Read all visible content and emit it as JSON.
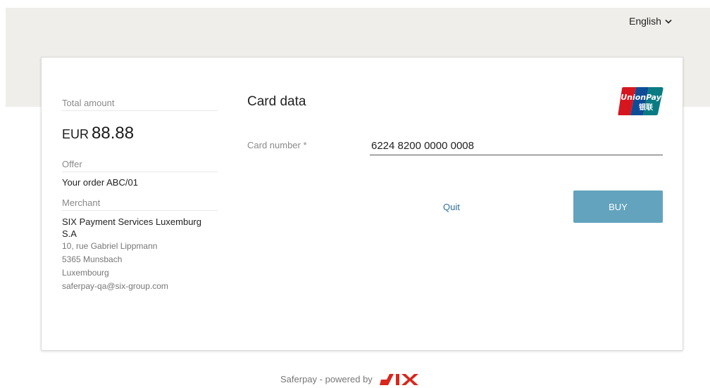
{
  "header": {
    "language": "English",
    "language_icon": "chevron-down-icon"
  },
  "summary": {
    "total_label": "Total amount",
    "currency": "EUR",
    "amount": "88.88",
    "offer_label": "Offer",
    "offer_value": "Your order ABC/01",
    "merchant_label": "Merchant",
    "merchant_name": "SIX Payment Services Luxemburg S.A",
    "address_lines": [
      "10, rue Gabriel Lippmann",
      "5365 Munsbach",
      "Luxembourg",
      "saferpay-qa@six-group.com"
    ]
  },
  "form": {
    "title": "Card data",
    "logo": "unionpay-logo",
    "logo_text_top": "UnionPay",
    "logo_text_bottom": "银联",
    "card_number_label": "Card number *",
    "card_number_value": "6224 8200 0000 0008",
    "quit_label": "Quit",
    "buy_label": "BUY"
  },
  "footer": {
    "text": "Saferpay - powered by",
    "logo": "six-logo",
    "logo_text": "SIX"
  },
  "colors": {
    "band": "#f0eeea",
    "buy_button": "#63a3bd",
    "link": "#2f6f9c",
    "six_red": "#d8271c",
    "unionpay_red": "#d6161e",
    "unionpay_blue": "#0e4c96",
    "unionpay_teal": "#0a7b83"
  }
}
